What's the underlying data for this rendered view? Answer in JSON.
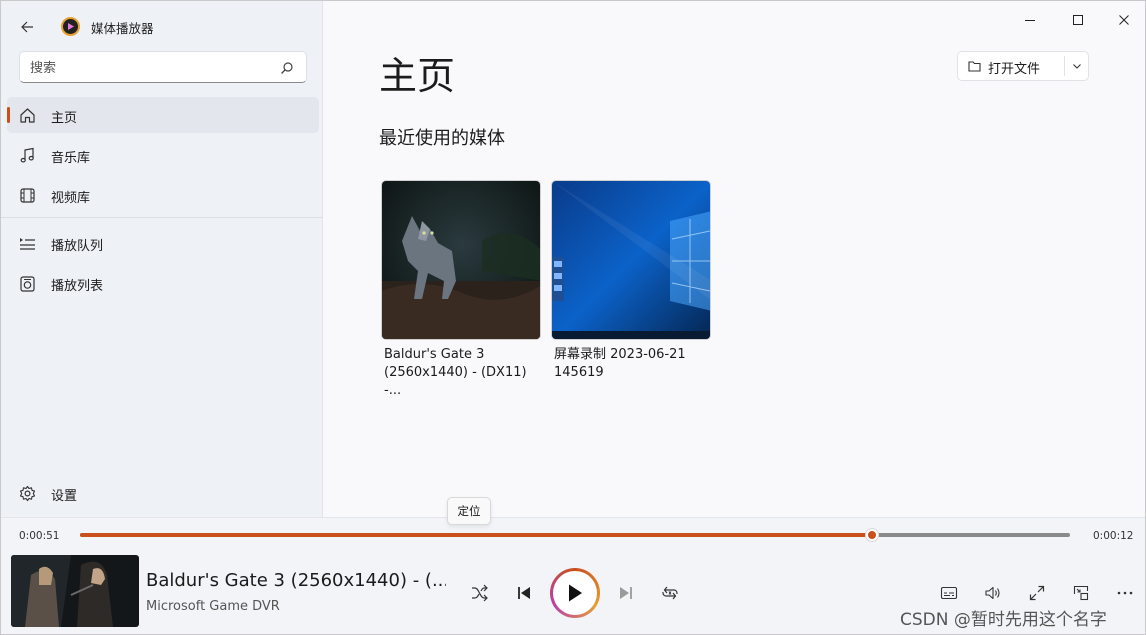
{
  "app": {
    "title": "媒体播放器"
  },
  "search": {
    "placeholder": "搜索"
  },
  "sidebar": {
    "items": [
      {
        "label": "主页",
        "icon": "home-icon",
        "active": true
      },
      {
        "label": "音乐库",
        "icon": "music-note-icon"
      },
      {
        "label": "视频库",
        "icon": "film-icon"
      },
      {
        "label": "播放队列",
        "icon": "queue-icon"
      },
      {
        "label": "播放列表",
        "icon": "playlist-icon"
      }
    ],
    "settings_label": "设置"
  },
  "main": {
    "title": "主页",
    "open_file_label": "打开文件",
    "section_title": "最近使用的媒体",
    "recent": [
      {
        "title": "Baldur's Gate 3 (2560x1440) - (DX11) -...",
        "line1": "Baldur's Gate 3",
        "line2": "(2560x1440) - (DX11) -..."
      },
      {
        "title": "屏幕录制 2023-06-21 145619",
        "line1": "屏幕录制 2023-06-21",
        "line2": "145619"
      }
    ]
  },
  "player": {
    "elapsed": "0:00:51",
    "remaining": "0:00:12",
    "progress": 0.8,
    "tooltip": "定位",
    "now_playing_title": "Baldur's Gate 3 (2560x1440) - (...",
    "now_playing_subtitle": "Microsoft Game DVR"
  },
  "watermark": "CSDN @暂时先用这个名字",
  "colors": {
    "accent": "#c94f1b",
    "sidebar_bg": "#eef1f6",
    "main_bg": "#f9f9fb"
  }
}
